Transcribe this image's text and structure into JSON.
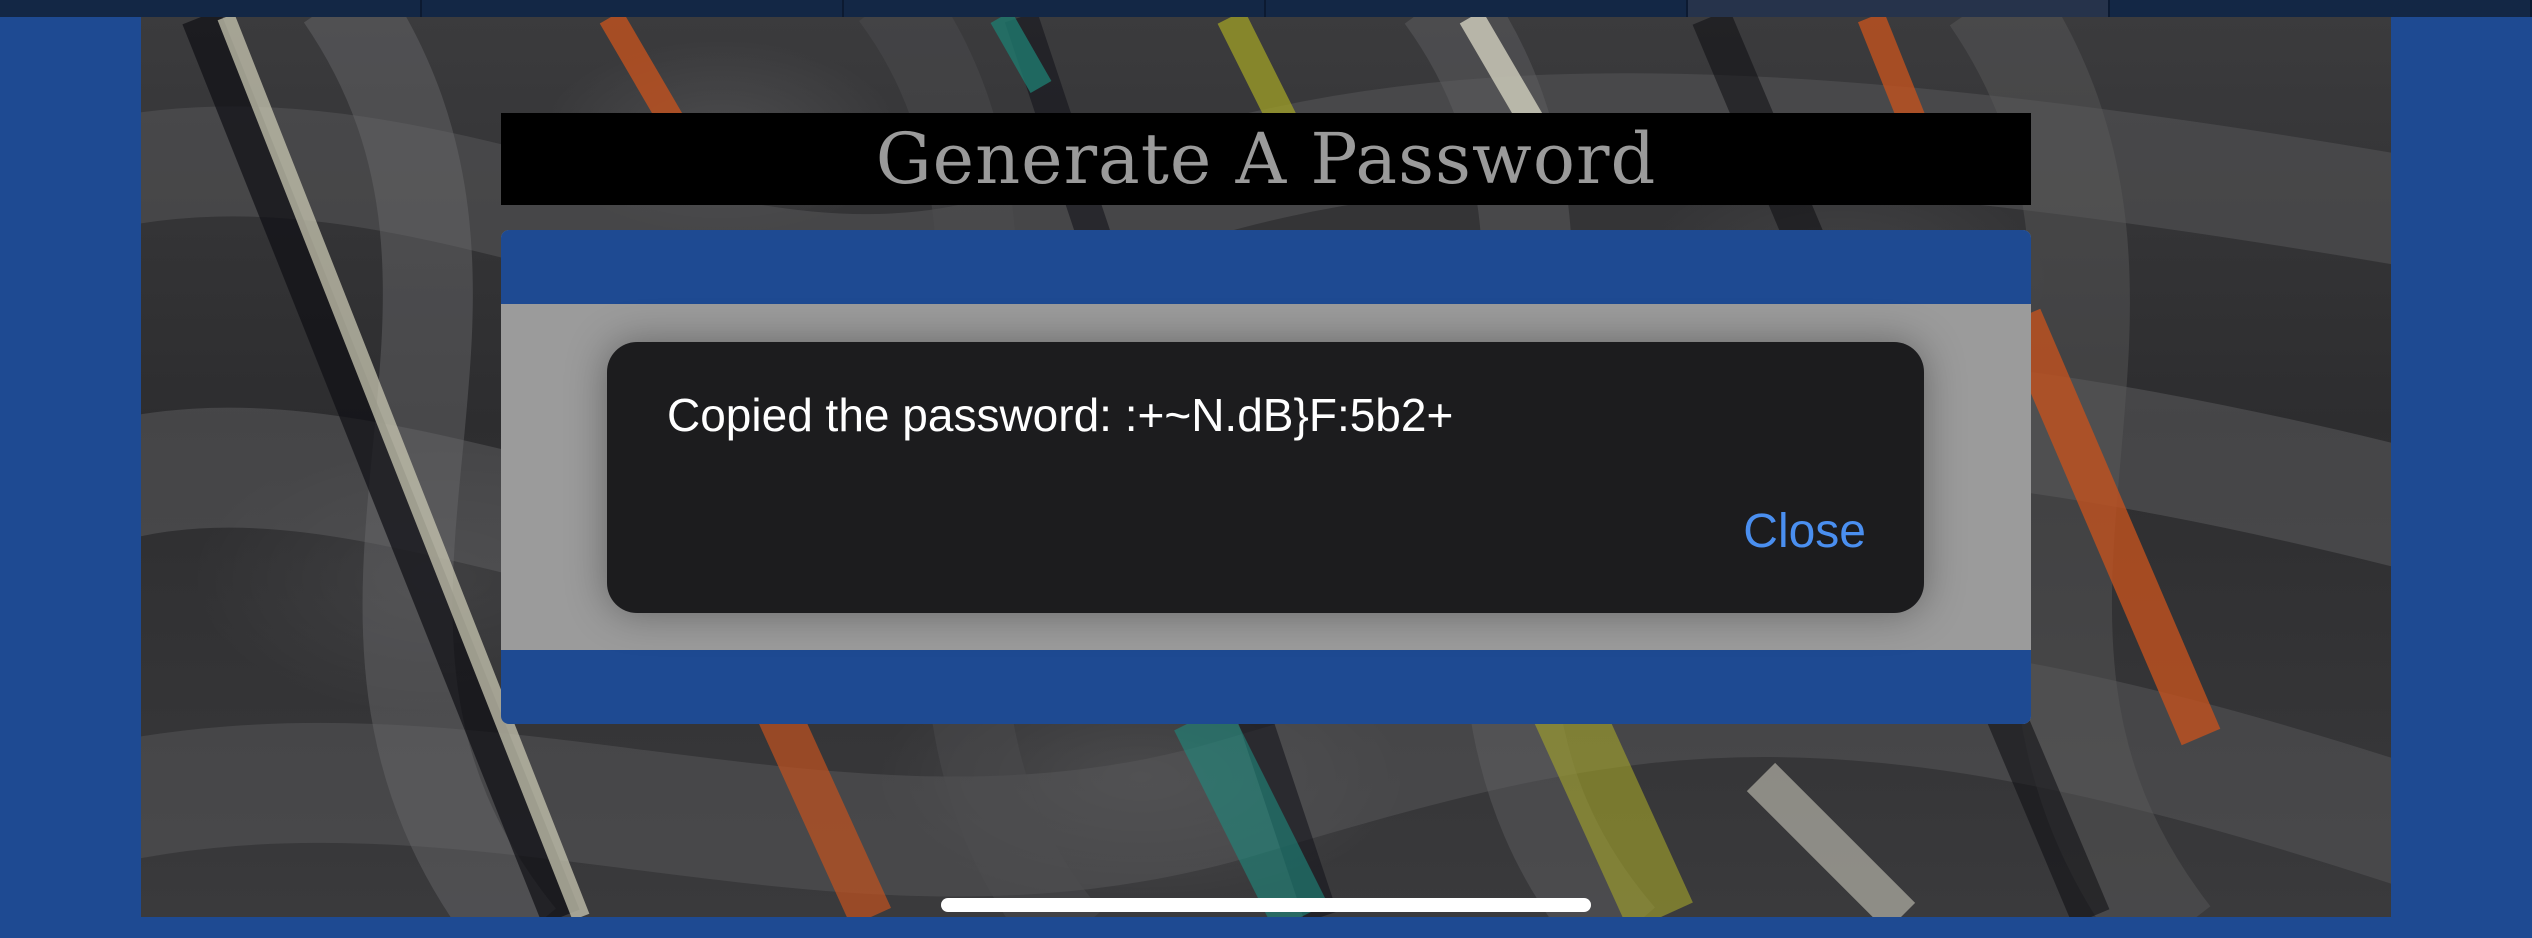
{
  "page": {
    "title": "Generate A Password"
  },
  "alert": {
    "message": "Copied the password: :+~N.dB}F:5b2+",
    "close_label": "Close"
  },
  "colors": {
    "frame_blue": "#1e4a92",
    "title_bg": "#000000",
    "title_text": "#9a9a9a",
    "alert_bg": "#1c1c1e",
    "alert_text": "#ffffff",
    "action_blue": "#4a8ff0",
    "dialog_gray": "#9b9b9b"
  }
}
